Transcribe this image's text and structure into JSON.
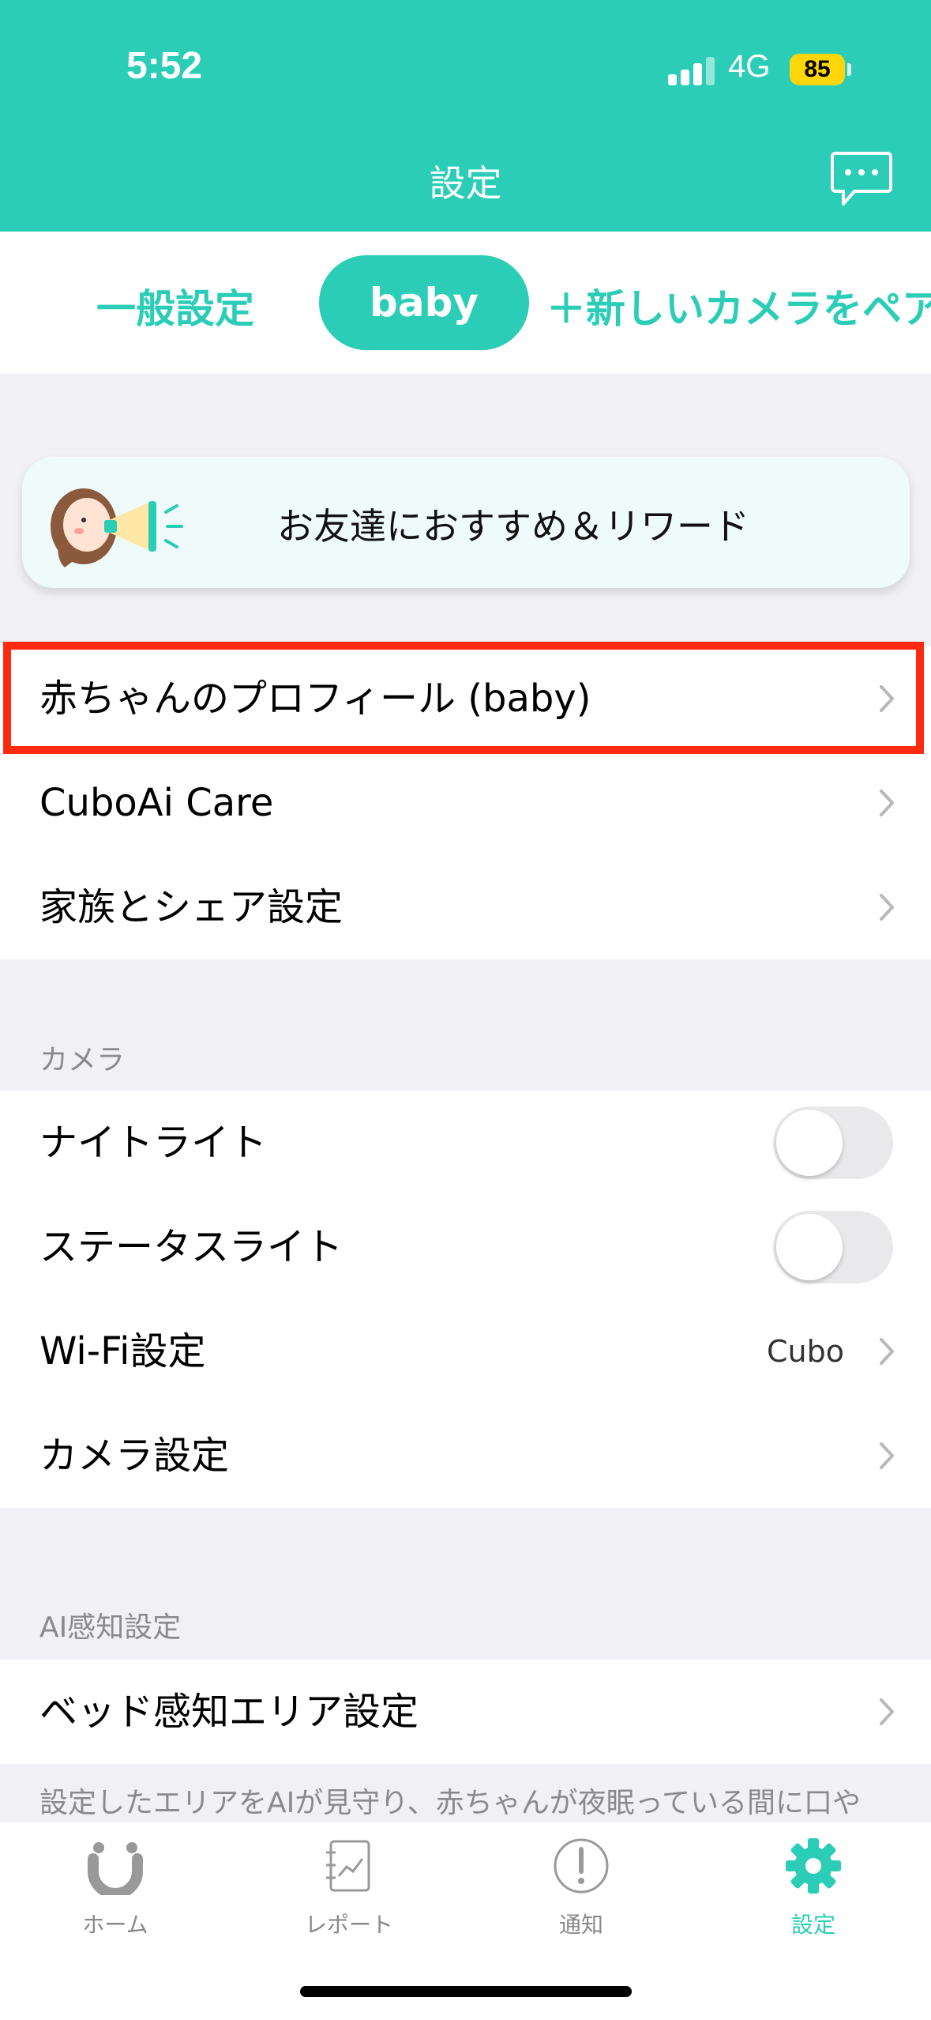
{
  "status_bar": {
    "time": "5:52",
    "network": "4G",
    "battery": "85"
  },
  "header": {
    "title": "設定"
  },
  "tabs": {
    "general": "一般設定",
    "baby": "baby",
    "new_camera": "＋新しいカメラをペア"
  },
  "promo": {
    "label": "お友達におすすめ＆リワード"
  },
  "profile_group": {
    "items": [
      {
        "label": "赤ちゃんのプロフィール (baby)"
      },
      {
        "label": "CuboAi Care"
      },
      {
        "label": "家族とシェア設定"
      }
    ]
  },
  "camera_section": {
    "header": "カメラ",
    "night_light": {
      "label": "ナイトライト",
      "on": false
    },
    "status_light": {
      "label": "ステータスライト",
      "on": false
    },
    "wifi": {
      "label": "Wi-Fi設定",
      "value": "Cubo"
    },
    "camera_settings": {
      "label": "カメラ設定"
    }
  },
  "ai_section": {
    "header": "AI感知設定",
    "bed_area": {
      "label": "ベッド感知エリア設定"
    },
    "footnote": "設定したエリアをAIが見守り、赤ちゃんが夜眠っている間に口や"
  },
  "tab_bar": {
    "items": [
      {
        "label": "ホーム",
        "icon": "home-icon"
      },
      {
        "label": "レポート",
        "icon": "report-icon"
      },
      {
        "label": "通知",
        "icon": "notification-icon"
      },
      {
        "label": "設定",
        "icon": "settings-icon"
      }
    ]
  },
  "colors": {
    "accent": "#2bcdb6",
    "highlight": "#ff2a10"
  }
}
